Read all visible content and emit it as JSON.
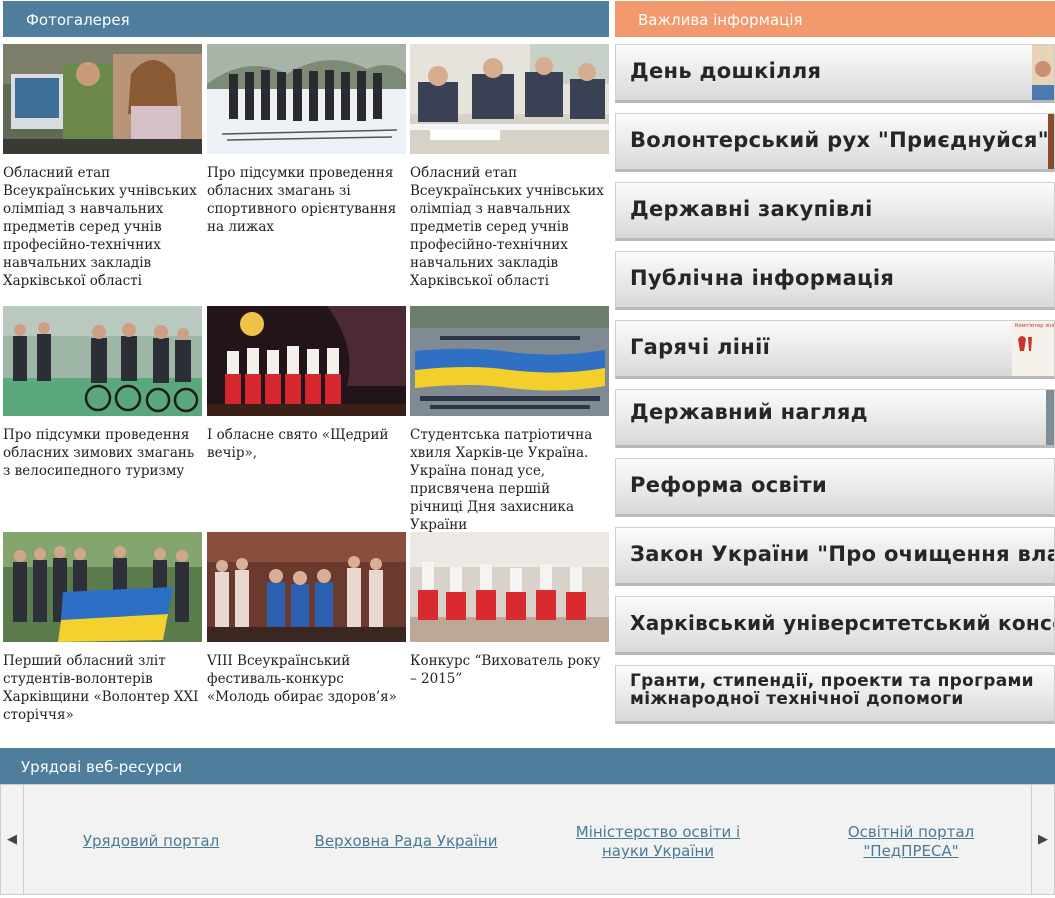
{
  "gallery": {
    "title": "Фотогалерея",
    "items": [
      {
        "caption": "Обласний етап Всеукраїнських учнівських олімпіад з навчальних предметів серед учнів професійно-технічних навчальних закладів Харківської області"
      },
      {
        "caption": "Про підсумки проведення обласних змагань зі спортивного орієнтування на лижах"
      },
      {
        "caption": "Обласний етап Всеукраїнських учнівських олімпіад з навчальних предметів серед учнів професійно-технічних навчальних закладів Харківської області"
      },
      {
        "caption": "Про підсумки проведення обласних зимових змагань з велосипедного туризму"
      },
      {
        "caption": "І обласне свято «Щедрий вечір»,"
      },
      {
        "caption": "Студентська патріотична хвиля Харків-це Україна. Україна понад усе, присвячена першій річниці Дня захисника України"
      },
      {
        "caption": "Перший обласний зліт студентів-волонтерів Харківщини «Волонтер ХХІ сторіччя»"
      },
      {
        "caption": "VIII Всеукраїнський фестиваль-конкурс «Молодь обирає здоров’я»"
      },
      {
        "caption": "Конкурс “Вихователь року – 2015”"
      }
    ]
  },
  "info": {
    "title": "Важлива інформація",
    "banners": [
      {
        "label": "День дошкілля"
      },
      {
        "label": "Волонтерський рух \"Приєднуйся\""
      },
      {
        "label": "Державні закупівлі"
      },
      {
        "label": "Публічна інформація"
      },
      {
        "label": "Гарячі лінії",
        "deco_text": "Комп'ютер лінії"
      },
      {
        "label": "Державний нагляд"
      },
      {
        "label": "Реформа освіти"
      },
      {
        "label": "Закон України \"Про очищення влади\""
      },
      {
        "label": "Харківський університетський консорціум"
      },
      {
        "label": "Гранти, стипендії, проекти та програми міжнародної технічної допомоги"
      }
    ]
  },
  "gov": {
    "title": "Урядові веб-ресурси",
    "links": [
      {
        "label": "Урядовий портал"
      },
      {
        "label": "Верховна Рада України"
      },
      {
        "label": "Міністерство освіти і науки України"
      },
      {
        "label": "Освітній портал \"ПедПРЕСА\""
      }
    ],
    "prev_icon": "triangle-left-icon",
    "next_icon": "triangle-right-icon"
  },
  "colors": {
    "blue_header": "#4f7d9c",
    "orange_header": "#f29a6d",
    "link": "#4b7a97"
  }
}
